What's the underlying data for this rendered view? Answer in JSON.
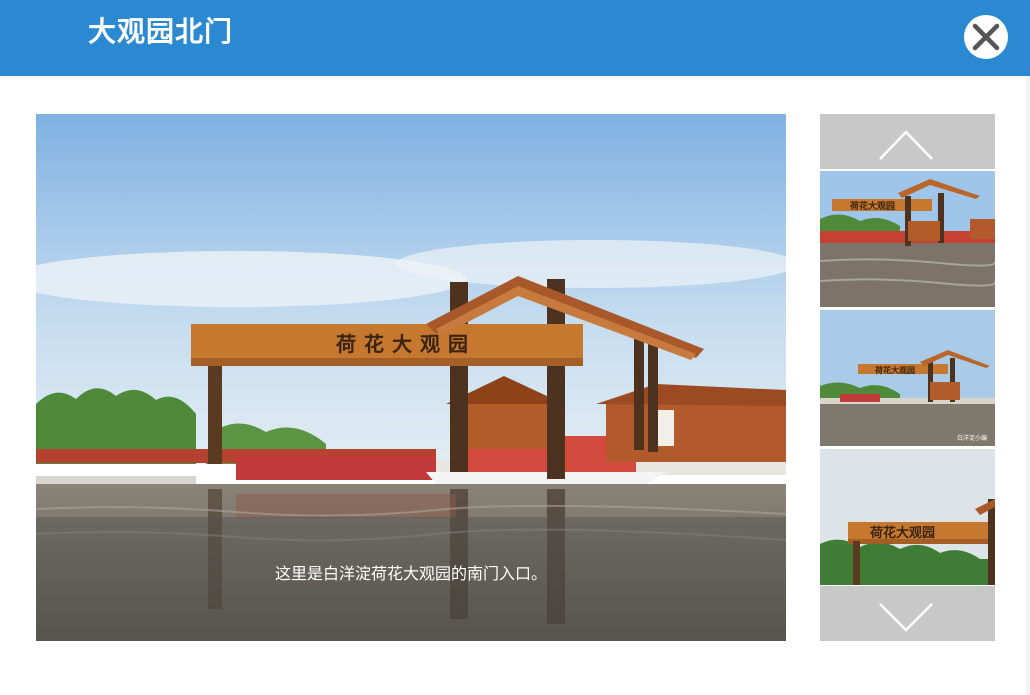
{
  "dialog": {
    "title": "大观园北门",
    "close_icon": "close-icon"
  },
  "viewer": {
    "sign_text": "荷花大观园",
    "caption": "这里是白洋淀荷花大观园的南门入口。"
  },
  "thumbnails": {
    "up_icon": "chevron-up-icon",
    "down_icon": "chevron-down-icon",
    "items": [
      {
        "sign_text": "荷花大观园"
      },
      {
        "sign_text": "荷花大观园",
        "corner_text": "白洋淀小编"
      },
      {
        "sign_text": "荷花大观园"
      }
    ]
  },
  "colors": {
    "header": "#2a89d0",
    "nav_button": "#c8c8c8",
    "wood": "#b8662a",
    "sky": "#9fc3e6",
    "water": "#6d655b"
  }
}
